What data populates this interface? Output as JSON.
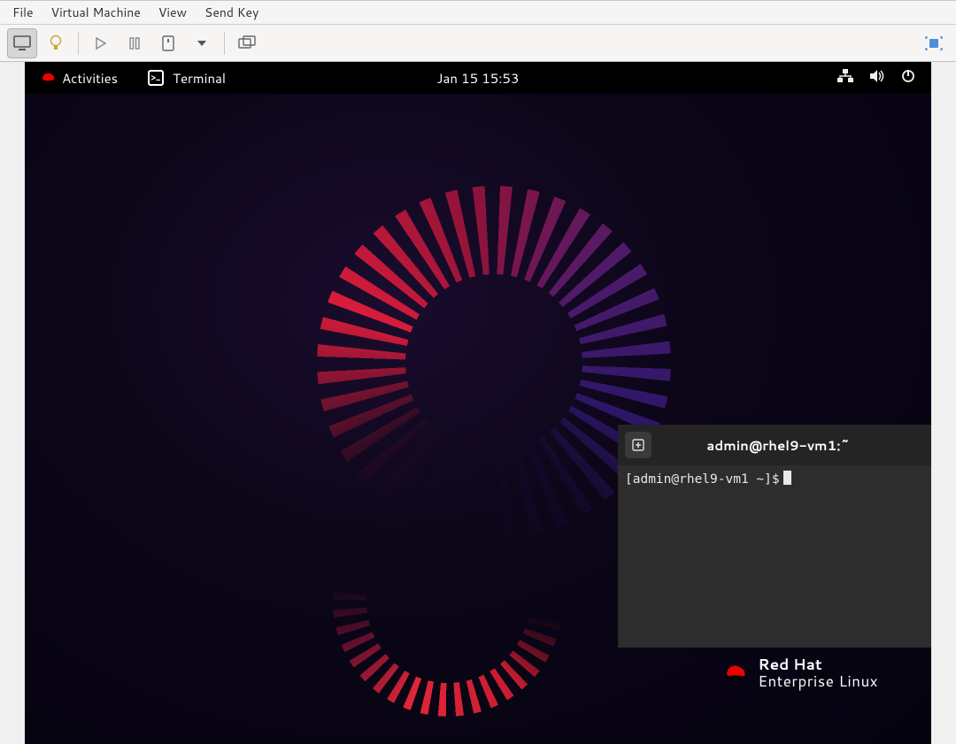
{
  "host": {
    "menus": {
      "file": "File",
      "vm": "Virtual Machine",
      "view": "View",
      "sendkey": "Send Key"
    }
  },
  "gnome": {
    "activities": "Activities",
    "app_name": "Terminal",
    "clock": "Jan 15  15:53"
  },
  "branding": {
    "line1": "Red Hat",
    "line2": "Enterprise Linux"
  },
  "terminal": {
    "title": "admin@rhel9-vm1:~",
    "prompt": "[admin@rhel9-vm1 ~]$"
  }
}
